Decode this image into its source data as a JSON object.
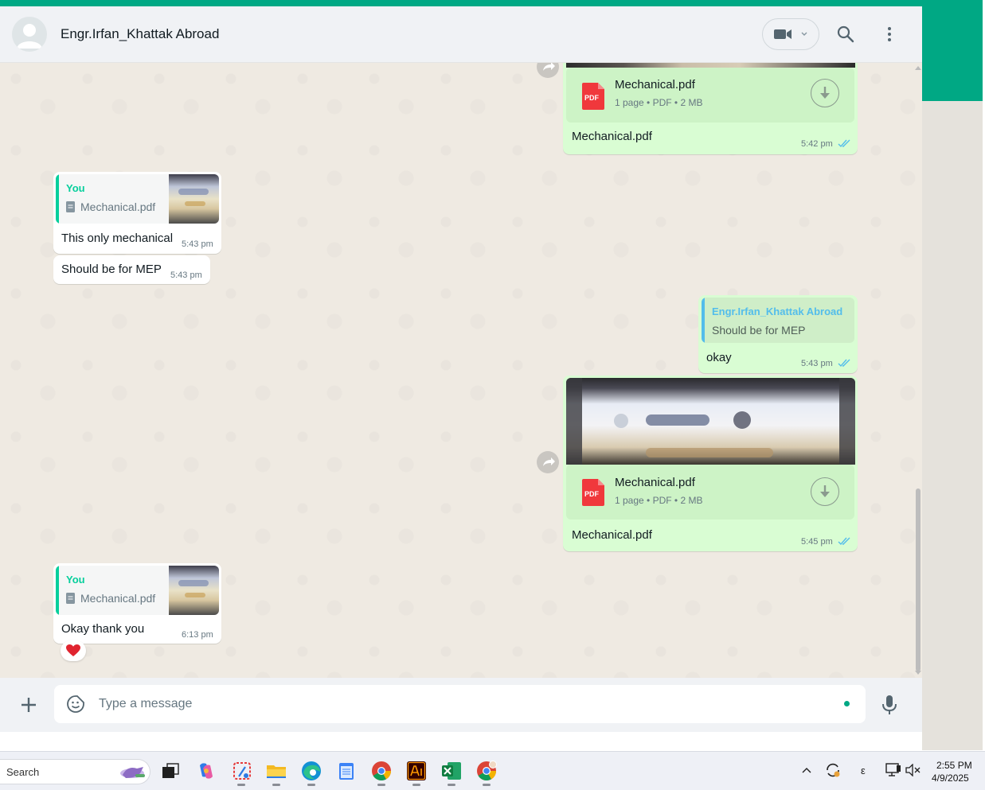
{
  "header": {
    "contact_name": "Engr.Irfan_Khattak Abroad"
  },
  "messages": {
    "m1": {
      "doc_name": "Mechanical.pdf",
      "doc_meta": "1 page • PDF • 2 MB",
      "caption": "Mechanical.pdf",
      "time": "5:42 pm",
      "pdf_label": "PDF"
    },
    "m2": {
      "quote_author": "You",
      "quote_text": "Mechanical.pdf",
      "text": "This only mechanical",
      "time": "5:43 pm"
    },
    "m3": {
      "text": "Should be for MEP",
      "time": "5:43 pm"
    },
    "m4": {
      "quote_author": "Engr.Irfan_Khattak Abroad",
      "quote_text": "Should be for MEP",
      "text": "okay",
      "time": "5:43 pm"
    },
    "m5": {
      "doc_name": "Mechanical.pdf",
      "doc_meta": "1 page • PDF • 2 MB",
      "caption": "Mechanical.pdf",
      "time": "5:45 pm",
      "pdf_label": "PDF"
    },
    "m6": {
      "quote_author": "You",
      "quote_text": "Mechanical.pdf",
      "text": "Okay thank you",
      "time": "6:13 pm",
      "reaction": "heart"
    }
  },
  "composer": {
    "placeholder": "Type a message"
  },
  "taskbar": {
    "search_label": "Search",
    "time": "2:55 PM",
    "date": "4/9/2025",
    "lang": "ε"
  },
  "colors": {
    "accent": "#00a884",
    "outgoing_bubble": "#d9fdd3",
    "incoming_bubble": "#ffffff",
    "chat_background": "#efeae2",
    "quote_you": "#06cf9c",
    "quote_contact": "#53bdeb",
    "read_ticks": "#53bdeb"
  }
}
